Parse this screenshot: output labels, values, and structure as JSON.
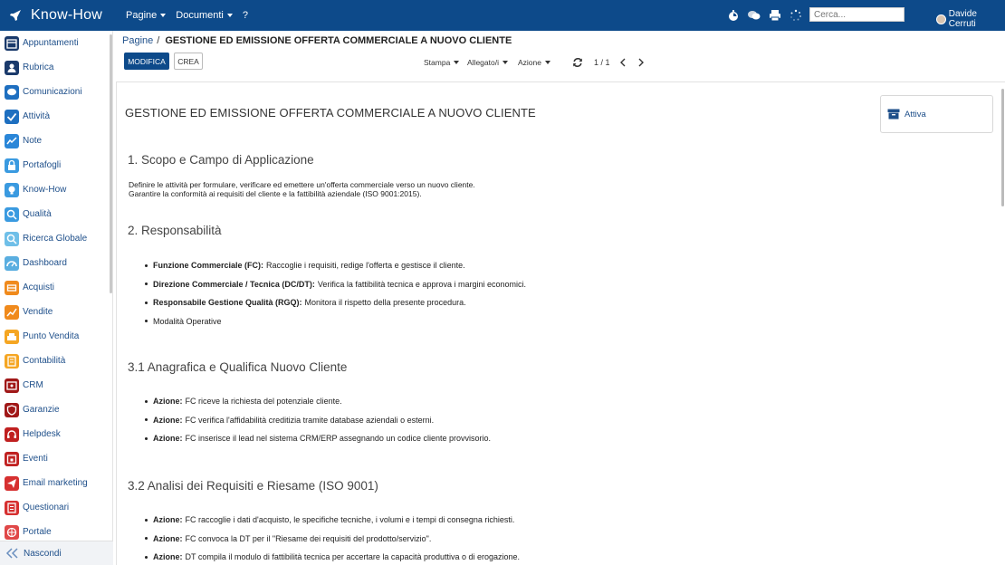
{
  "app": {
    "title": "Know-How"
  },
  "topnav": {
    "pagine": "Pagine",
    "documenti": "Documenti",
    "help": "?"
  },
  "search": {
    "placeholder": "Cerca..."
  },
  "user": {
    "name": "Davide Cerruti"
  },
  "sidebar": {
    "items": [
      {
        "label": "Appuntamenti",
        "color": "#1a3a6b",
        "icon": "calendar-icon"
      },
      {
        "label": "Rubrica",
        "color": "#1a3a6b",
        "icon": "contacts-icon"
      },
      {
        "label": "Comunicazioni",
        "color": "#1e6fc0",
        "icon": "chat-icon"
      },
      {
        "label": "Attività",
        "color": "#1e6fc0",
        "icon": "check-icon"
      },
      {
        "label": "Note",
        "color": "#2a86d8",
        "icon": "note-icon"
      },
      {
        "label": "Portafogli",
        "color": "#3a9ae0",
        "icon": "lock-icon"
      },
      {
        "label": "Know-How",
        "color": "#3a9ae0",
        "icon": "bulb-icon"
      },
      {
        "label": "Qualità",
        "color": "#3a9ae0",
        "icon": "search-icon"
      },
      {
        "label": "Ricerca Globale",
        "color": "#6fbfe8",
        "icon": "globe-search-icon"
      },
      {
        "label": "Dashboard",
        "color": "#5aaee0",
        "icon": "dashboard-icon"
      },
      {
        "label": "Acquisti",
        "color": "#f08a1c",
        "icon": "cart-icon"
      },
      {
        "label": "Vendite",
        "color": "#f08a1c",
        "icon": "chart-icon"
      },
      {
        "label": "Punto Vendita",
        "color": "#f5a623",
        "icon": "register-icon"
      },
      {
        "label": "Contabilità",
        "color": "#f5a623",
        "icon": "ledger-icon"
      },
      {
        "label": "CRM",
        "color": "#a01818",
        "icon": "crm-icon"
      },
      {
        "label": "Garanzie",
        "color": "#a01818",
        "icon": "shield-icon"
      },
      {
        "label": "Helpdesk",
        "color": "#c02020",
        "icon": "headset-icon"
      },
      {
        "label": "Eventi",
        "color": "#c02020",
        "icon": "event-icon"
      },
      {
        "label": "Email marketing",
        "color": "#d63030",
        "icon": "send-icon"
      },
      {
        "label": "Questionari",
        "color": "#d63030",
        "icon": "survey-icon"
      },
      {
        "label": "Portale",
        "color": "#e04848",
        "icon": "portal-icon"
      }
    ],
    "footer": "Nascondi"
  },
  "breadcrumb": {
    "link": "Pagine",
    "sep": "/",
    "title": "GESTIONE ED EMISSIONE OFFERTA COMMERCIALE A NUOVO CLIENTE"
  },
  "toolbar": {
    "modifica": "MODIFICA",
    "crea": "CREA",
    "stampa": "Stampa",
    "allegati": "Allegato/i",
    "azione": "Azione",
    "pager": "1 / 1"
  },
  "status": {
    "label": "Attiva"
  },
  "doc": {
    "title": "GESTIONE ED EMISSIONE OFFERTA COMMERCIALE A NUOVO CLIENTE",
    "s1": {
      "heading": "1. Scopo e Campo di Applicazione",
      "line1": "Definire le attività per formulare, verificare ed emettere un'offerta commerciale verso un nuovo cliente.",
      "line2": "Garantire la conformità ai requisiti del cliente e la fattibilità aziendale (ISO 9001:2015)."
    },
    "s2": {
      "heading": "2. Responsabilità",
      "items": [
        {
          "bold": "Funzione Commerciale (FC):",
          "text": "Raccoglie i requisiti, redige l'offerta e gestisce il cliente."
        },
        {
          "bold": "Direzione Commerciale / Tecnica (DC/DT):",
          "text": "Verifica la fattibilità tecnica e approva i margini economici."
        },
        {
          "bold": "Responsabile Gestione Qualità (RGQ):",
          "text": "Monitora il rispetto della presente procedura."
        },
        {
          "bold": "",
          "text": "Modalità Operative"
        }
      ]
    },
    "s31": {
      "heading": "3.1 Anagrafica e Qualifica Nuovo Cliente",
      "items": [
        {
          "bold": "Azione:",
          "text": "FC riceve la richiesta del potenziale cliente."
        },
        {
          "bold": "Azione:",
          "text": "FC verifica l'affidabilità creditizia tramite database aziendali o esterni."
        },
        {
          "bold": "Azione:",
          "text": "FC inserisce il lead nel sistema CRM/ERP assegnando un codice cliente provvisorio."
        }
      ]
    },
    "s32": {
      "heading": "3.2 Analisi dei Requisiti e Riesame (ISO 9001)",
      "items": [
        {
          "bold": "Azione:",
          "text": "FC raccoglie i dati d'acquisto, le specifiche tecniche, i volumi e i tempi di consegna richiesti."
        },
        {
          "bold": "Azione:",
          "text": "FC convoca la DT per il \"Riesame dei requisiti del prodotto/servizio\"."
        },
        {
          "bold": "Azione:",
          "text": "DT compila il modulo di fattibilità tecnica per accertare la capacità produttiva o di erogazione."
        }
      ]
    }
  }
}
